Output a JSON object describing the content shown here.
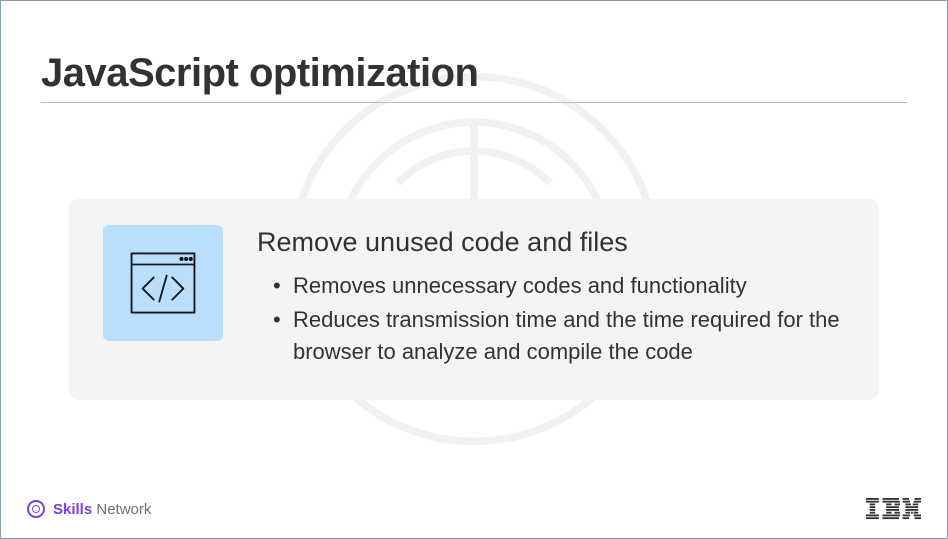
{
  "title": "JavaScript optimization",
  "card": {
    "heading": "Remove unused code and files",
    "bullets": [
      "Removes unnecessary codes and functionality",
      "Reduces transmission time and the time required for the browser to analyze and compile the code"
    ]
  },
  "footer": {
    "skills_word": "Skills",
    "network_word": "Network",
    "company": "IBM"
  }
}
